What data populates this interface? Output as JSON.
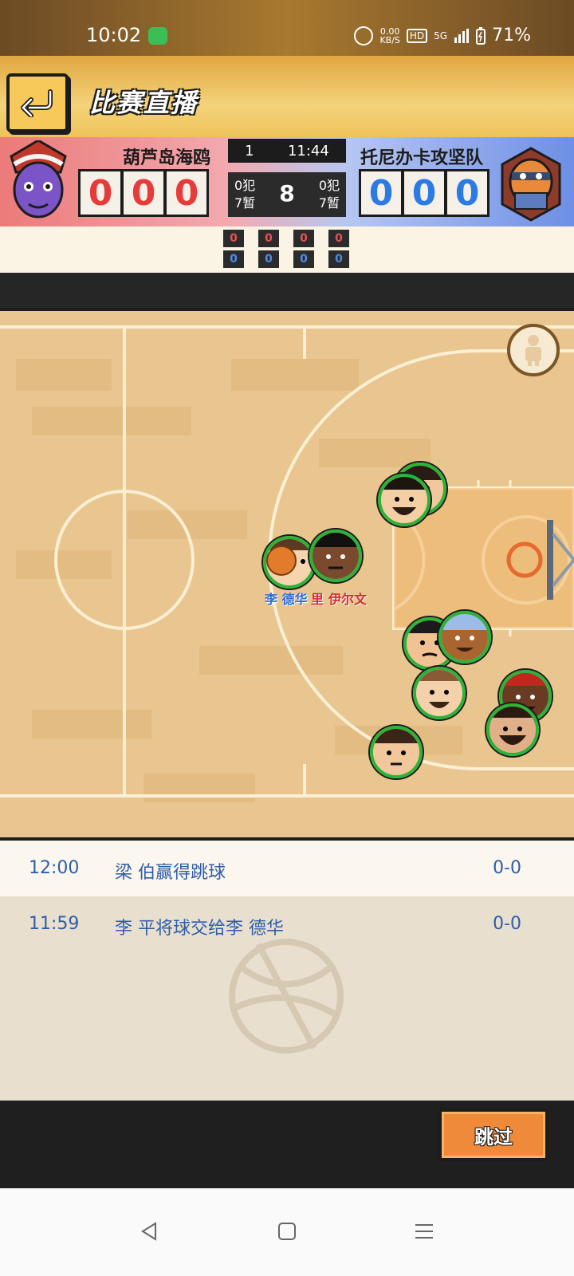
{
  "status_bar": {
    "time": "10:02",
    "net_speed": "0.00",
    "net_unit": "KB/S",
    "hd": "HD",
    "network": "5G",
    "battery": "71%"
  },
  "header": {
    "title": "比赛直播"
  },
  "scoreboard": {
    "home": {
      "name": "葫芦岛海鸥",
      "digits": [
        "0",
        "0",
        "0"
      ],
      "fouls": "0犯",
      "timeouts": "7暂",
      "color": "#e63b3b"
    },
    "away": {
      "name": "托尼办卡攻坚队",
      "digits": [
        "0",
        "0",
        "0"
      ],
      "fouls": "0犯",
      "timeouts": "7暂",
      "color": "#2c7be5"
    },
    "quarter": "1",
    "clock": "11:44",
    "shot_clock": "8",
    "quarter_scores": {
      "home": [
        "0",
        "0",
        "0",
        "0"
      ],
      "away": [
        "0",
        "0",
        "0",
        "0"
      ]
    }
  },
  "court": {
    "labels": {
      "blue_player": "李 德华",
      "red_player_a": "里",
      "red_player_b": "伊尔文"
    }
  },
  "play_log": [
    {
      "time": "12:00",
      "text": "梁 伯赢得跳球",
      "score": "0-0"
    },
    {
      "time": "11:59",
      "text": "李 平将球交给李 德华",
      "score": "0-0"
    }
  ],
  "footer": {
    "skip_label": "跳过"
  },
  "icons": {
    "back": "back-arrow-icon",
    "view": "player-view-icon",
    "nav_back": "nav-back-icon",
    "nav_home": "nav-home-icon",
    "nav_menu": "nav-menu-icon"
  }
}
